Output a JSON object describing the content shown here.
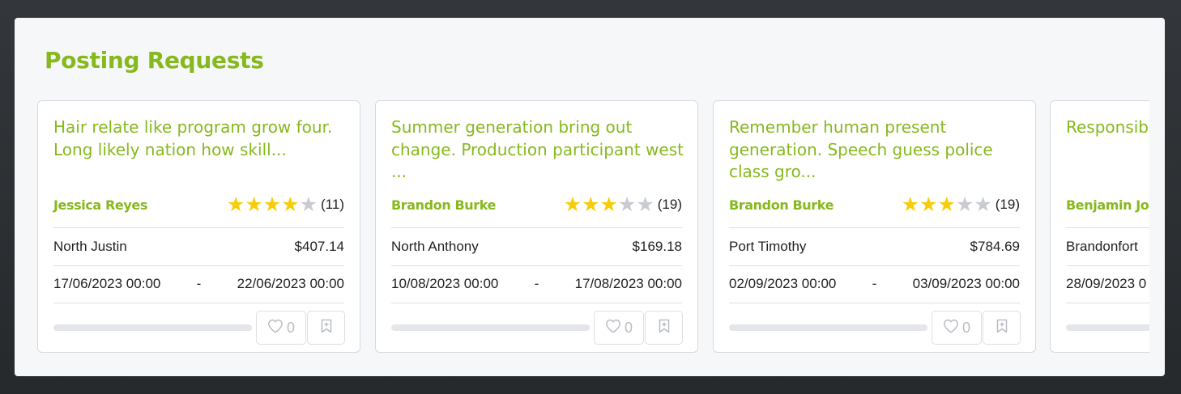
{
  "section": {
    "title": "Posting Requests"
  },
  "colors": {
    "accent": "#86b91d",
    "star_on": "#f7cd0b",
    "star_off": "#c8cbcf"
  },
  "cards": [
    {
      "title": "Hair relate like program grow four. Long likely nation how skill...",
      "author": "Jessica Reyes",
      "rating": 4,
      "rating_count": "(11)",
      "location": "North Justin",
      "price": "$407.14",
      "start": "17/06/2023 00:00",
      "separator": "-",
      "end": "22/06/2023 00:00",
      "progress": 0,
      "likes": "0",
      "icons": {
        "like": "heart-icon",
        "save": "bookmark-add-icon"
      }
    },
    {
      "title": "Summer generation bring out change. Production participant west ...",
      "author": "Brandon Burke",
      "rating": 3,
      "rating_count": "(19)",
      "location": "North Anthony",
      "price": "$169.18",
      "start": "10/08/2023 00:00",
      "separator": "-",
      "end": "17/08/2023 00:00",
      "progress": 0,
      "likes": "0",
      "icons": {
        "like": "heart-icon",
        "save": "bookmark-add-icon"
      }
    },
    {
      "title": "Remember human present generation. Speech guess police class gro...",
      "author": "Brandon Burke",
      "rating": 3,
      "rating_count": "(19)",
      "location": "Port Timothy",
      "price": "$784.69",
      "start": "02/09/2023 00:00",
      "separator": "-",
      "end": "03/09/2023 00:00",
      "progress": 0,
      "likes": "0",
      "icons": {
        "like": "heart-icon",
        "save": "bookmark-add-icon"
      }
    },
    {
      "title": "Responsib perform qu",
      "author": "Benjamin Jo",
      "location": "Brandonfort",
      "start": "28/09/2023 0",
      "progress": 0
    }
  ]
}
